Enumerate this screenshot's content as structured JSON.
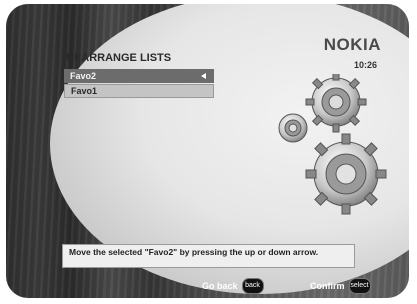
{
  "header": {
    "brand": "NOKIA",
    "time": "10:26"
  },
  "screen": {
    "title": "REARRANGE LISTS"
  },
  "lists": [
    {
      "label": "Favo2",
      "selected": true
    },
    {
      "label": "Favo1",
      "selected": false
    }
  ],
  "hint": "Move the selected \"Favo2\" by pressing the up or down arrow.",
  "footer": {
    "back_label": "Go back",
    "back_key": "back",
    "confirm_label": "Confirm",
    "confirm_key": "select"
  },
  "icons": {
    "selection_marker": "left-triangle-icon",
    "decoration": "gears-icon"
  },
  "colors": {
    "selected_row": "#6c6c6c",
    "row": "#c4c4c4",
    "hint_bg": "#efefef",
    "frame": "#3a3a3a"
  }
}
